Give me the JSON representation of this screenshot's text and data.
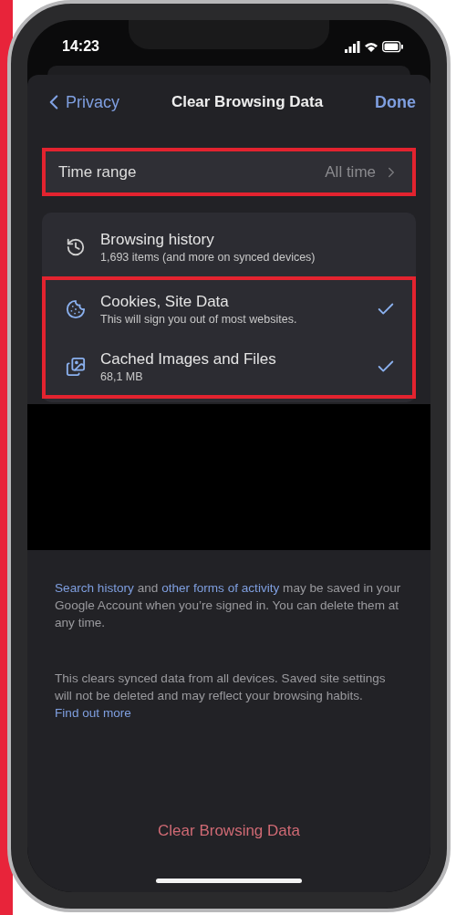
{
  "status_bar": {
    "time": "14:23"
  },
  "nav": {
    "back": "Privacy",
    "title": "Clear Browsing Data",
    "done": "Done"
  },
  "time_range": {
    "label": "Time range",
    "value": "All time",
    "highlighted": true
  },
  "data_types": [
    {
      "kind": "history",
      "title": "Browsing history",
      "subtitle": "1,693 items (and more on synced devices)",
      "checked": false,
      "highlighted": false
    },
    {
      "kind": "cookies",
      "title": "Cookies, Site Data",
      "subtitle": "This will sign you out of most websites.",
      "checked": true,
      "highlighted": true
    },
    {
      "kind": "cache",
      "title": "Cached Images and Files",
      "subtitle": "68,1 MB",
      "checked": true,
      "highlighted": true
    }
  ],
  "notes": [
    [
      {
        "text": "Search history",
        "link": true
      },
      {
        "text": " and ",
        "link": false
      },
      {
        "text": "other forms of activity",
        "link": true
      },
      {
        "text": " may be saved in your Google Account when you’re signed in. You can delete them at any time.",
        "link": false
      }
    ],
    [
      {
        "text": "This clears synced data from all devices. Saved site settings will not be deleted and may reflect your browsing habits. ",
        "link": false
      },
      {
        "text": "Find out more",
        "link": true
      }
    ]
  ],
  "clear_button": "Clear Browsing Data"
}
